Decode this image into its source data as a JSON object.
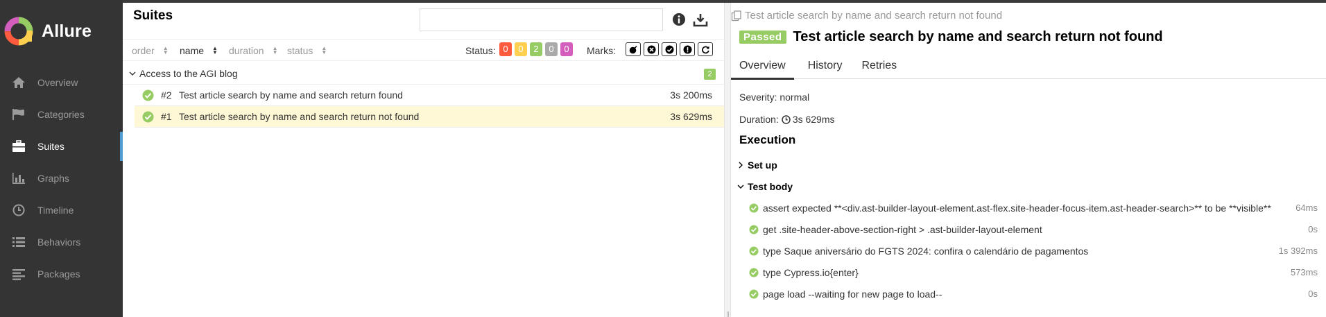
{
  "app": {
    "name": "Allure"
  },
  "sidebar": {
    "items": [
      {
        "label": "Overview",
        "icon": "home-icon"
      },
      {
        "label": "Categories",
        "icon": "flag-icon"
      },
      {
        "label": "Suites",
        "icon": "briefcase-icon",
        "active": true
      },
      {
        "label": "Graphs",
        "icon": "bar-chart-icon"
      },
      {
        "label": "Timeline",
        "icon": "clock-icon"
      },
      {
        "label": "Behaviors",
        "icon": "list-icon"
      },
      {
        "label": "Packages",
        "icon": "align-left-icon"
      }
    ]
  },
  "suites": {
    "title": "Suites",
    "search": {
      "value": "",
      "placeholder": ""
    },
    "sort": {
      "order": "order",
      "name": "name",
      "duration": "duration",
      "status": "status"
    },
    "status_label": "Status:",
    "status_counts": {
      "failed": "0",
      "broken": "0",
      "passed": "2",
      "skipped": "0",
      "unknown": "0"
    },
    "marks_label": "Marks:",
    "group": {
      "name": "Access to the AGI blog",
      "count": "2"
    },
    "tests": [
      {
        "num": "#2",
        "name": "Test article search by name and search return found",
        "duration": "3s 200ms"
      },
      {
        "num": "#1",
        "name": "Test article search by name and search return not found",
        "duration": "3s 629ms",
        "selected": true
      }
    ]
  },
  "detail": {
    "breadcrumb": "Test article search by name and search return not found",
    "status": "Passed",
    "title": "Test article search by name and search return not found",
    "tabs": [
      "Overview",
      "History",
      "Retries"
    ],
    "severity": "Severity: normal",
    "duration_label": "Duration:",
    "duration_value": "3s 629ms",
    "execution_title": "Execution",
    "setup_label": "Set up",
    "body_label": "Test body",
    "steps": [
      {
        "text": "assert expected **<div.ast-builder-layout-element.ast-flex.site-header-focus-item.ast-header-search>** to be **visible**",
        "duration": "64ms"
      },
      {
        "text": "get .site-header-above-section-right > .ast-builder-layout-element",
        "duration": "0s"
      },
      {
        "text": "type Saque aniversário do FGTS 2024: confira o calendário de pagamentos",
        "duration": "1s 392ms"
      },
      {
        "text": "type Cypress.io{enter}",
        "duration": "573ms"
      },
      {
        "text": "page load --waiting for new page to load--",
        "duration": "0s"
      }
    ]
  },
  "colors": {
    "sidebar_bg": "#343434",
    "active_accent": "#4e9cd2",
    "passed": "#97cc64",
    "failed": "#fd5a3e",
    "broken": "#ffd050",
    "skipped": "#aaaaaa",
    "unknown": "#d35ebe",
    "selected_row": "#fff8d6"
  }
}
